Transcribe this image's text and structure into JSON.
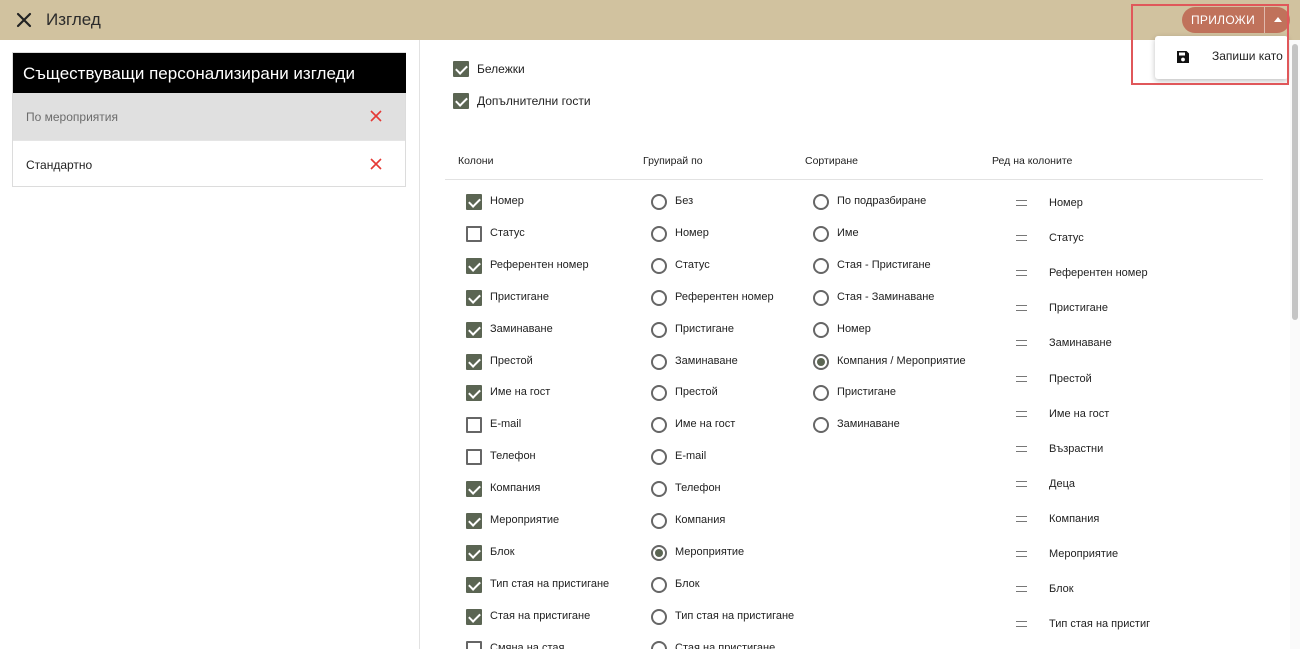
{
  "header": {
    "title": "Изглед",
    "apply_label": "ПРИЛОЖИ",
    "menu": {
      "save_as_label": "Запиши като"
    }
  },
  "views_panel": {
    "title": "Съществуващи персонализирани изгледи",
    "items": [
      {
        "label": "По мероприятия",
        "selected": true
      },
      {
        "label": "Стандартно",
        "selected": false
      }
    ]
  },
  "options": [
    {
      "label": "Бележки",
      "checked": true
    },
    {
      "label": "Допълнителни гости",
      "checked": true
    }
  ],
  "columns_section": {
    "headers": {
      "columns": "Колони",
      "group_by": "Групирай по",
      "sort": "Сортиране",
      "order": "Ред на колоните"
    },
    "columns": [
      {
        "label": "Номер",
        "checked": true
      },
      {
        "label": "Статус",
        "checked": false
      },
      {
        "label": "Референтен номер",
        "checked": true
      },
      {
        "label": "Пристигане",
        "checked": true
      },
      {
        "label": "Заминаване",
        "checked": true
      },
      {
        "label": "Престой",
        "checked": true
      },
      {
        "label": "Име на гост",
        "checked": true
      },
      {
        "label": "E-mail",
        "checked": false
      },
      {
        "label": "Телефон",
        "checked": false
      },
      {
        "label": "Компания",
        "checked": true
      },
      {
        "label": "Мероприятие",
        "checked": true
      },
      {
        "label": "Блок",
        "checked": true
      },
      {
        "label": "Тип стая на пристигане",
        "checked": true
      },
      {
        "label": "Стая на пристигане",
        "checked": true
      },
      {
        "label": "Смяна на стая",
        "checked": false
      }
    ],
    "group_by": [
      {
        "label": "Без",
        "selected": false
      },
      {
        "label": "Номер",
        "selected": false
      },
      {
        "label": "Статус",
        "selected": false
      },
      {
        "label": "Референтен номер",
        "selected": false
      },
      {
        "label": "Пристигане",
        "selected": false
      },
      {
        "label": "Заминаване",
        "selected": false
      },
      {
        "label": "Престой",
        "selected": false
      },
      {
        "label": "Име на гост",
        "selected": false
      },
      {
        "label": "E-mail",
        "selected": false
      },
      {
        "label": "Телефон",
        "selected": false
      },
      {
        "label": "Компания",
        "selected": false
      },
      {
        "label": "Мероприятие",
        "selected": true
      },
      {
        "label": "Блок",
        "selected": false
      },
      {
        "label": "Тип стая на пристигане",
        "selected": false
      },
      {
        "label": "Стая на пристигане",
        "selected": false
      }
    ],
    "sort": [
      {
        "label": "По подразбиране",
        "selected": false
      },
      {
        "label": "Име",
        "selected": false
      },
      {
        "label": "Стая - Пристигане",
        "selected": false
      },
      {
        "label": "Стая - Заминаване",
        "selected": false
      },
      {
        "label": "Номер",
        "selected": false
      },
      {
        "label": "Компания / Мероприятие",
        "selected": true
      },
      {
        "label": "Пристигане",
        "selected": false
      },
      {
        "label": "Заминаване",
        "selected": false
      }
    ],
    "order": [
      "Номер",
      "Статус",
      "Референтен номер",
      "Пристигане",
      "Заминаване",
      "Престой",
      "Име на гост",
      "Възрастни",
      "Деца",
      "Компания",
      "Мероприятие",
      "Блок",
      "Тип стая на пристигане"
    ]
  },
  "colors": {
    "topbar": "#d1c29f",
    "apply_button": "#c0725b",
    "checkbox_checked": "#5b6553",
    "delete_icon": "#e53935",
    "highlight_outline": "#e0575a"
  }
}
